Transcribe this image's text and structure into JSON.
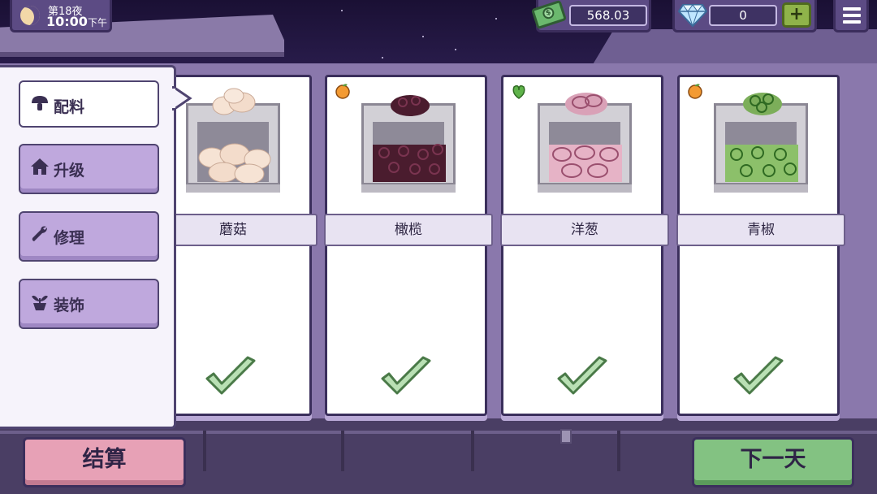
{
  "hud": {
    "night_label": "第18夜",
    "time": "10:00",
    "time_suffix": "下午",
    "money": "568.03",
    "gems": "0",
    "add_gems_label": "+"
  },
  "sidebar": {
    "tabs": [
      {
        "label": "配料",
        "icon": "mushroom-icon",
        "active": true
      },
      {
        "label": "升级",
        "icon": "house-icon",
        "active": false
      },
      {
        "label": "修理",
        "icon": "wrench-icon",
        "active": false
      },
      {
        "label": "装饰",
        "icon": "potted-plant-icon",
        "active": false
      }
    ]
  },
  "ingredients": [
    {
      "name": "蘑菇",
      "tag_icon": "",
      "selected": true,
      "color": "#f3d9c7"
    },
    {
      "name": "橄榄",
      "tag_icon": "orange-icon",
      "selected": true,
      "color": "#4a1c2e"
    },
    {
      "name": "洋葱",
      "tag_icon": "leaf-icon",
      "selected": true,
      "color": "#d9a1b7"
    },
    {
      "name": "青椒",
      "tag_icon": "orange-icon",
      "selected": true,
      "color": "#7cae5a"
    }
  ],
  "footer": {
    "settle_label": "结算",
    "next_day_label": "下一天"
  },
  "colors": {
    "check": "#b9e0b4",
    "check_stroke": "#4a7a48",
    "accent_purple": "#5c4b84"
  }
}
